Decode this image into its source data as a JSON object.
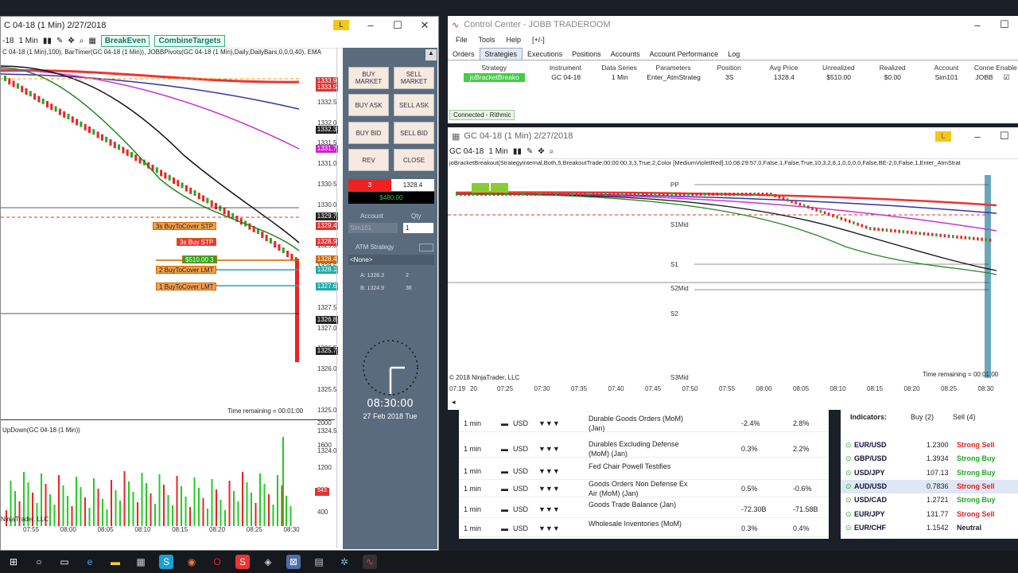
{
  "left_window": {
    "title": "C 04-18 (1 Min)  2/27/2018",
    "interval": "1 Min",
    "instrument": "-18",
    "breakeven_label": "BreakEven",
    "combine_label": "CombineTargets",
    "indicator_line": "C 04-18 (1 Min),100), BarTimer(GC 04-18 (1 Min)), JOBBPivots(GC 04-18 (1 Min),Daily,DailyBars,0,0,0,40), EMA",
    "price_ticks": [
      "1333.0",
      "1332.5",
      "1332.0",
      "1331.5",
      "1331.0",
      "1330.5",
      "1330.0",
      "1329.5",
      "1329.0",
      "1328.5",
      "1328.0",
      "1327.5",
      "1327.0",
      "1326.5",
      "1326.0",
      "1325.5",
      "1325.0",
      "1324.5",
      "1324.0"
    ],
    "price_labels": [
      {
        "text": "1333.9",
        "color": "#d33"
      },
      {
        "text": "1333.5",
        "color": "#d33"
      },
      {
        "text": "1332.3",
        "color": "#222"
      },
      {
        "text": "1331.7",
        "color": "#c2c"
      },
      {
        "text": "1329.7",
        "color": "#222"
      },
      {
        "text": "1329.4",
        "color": "#d33"
      },
      {
        "text": "1328.9",
        "color": "#d33"
      },
      {
        "text": "1328.4",
        "color": "#c60"
      },
      {
        "text": "1328.1",
        "color": "#2aa"
      },
      {
        "text": "1327.6",
        "color": "#2aa"
      },
      {
        "text": "1326.8",
        "color": "#222"
      },
      {
        "text": "1325.7",
        "color": "#222"
      }
    ],
    "orders": [
      {
        "text": "3s  BuyToCover STP",
        "bg": "#f6a04a"
      },
      {
        "text": "3s  Buy STP",
        "bg": "#e33"
      },
      {
        "text": "$510.00  3",
        "bg": "#2a2"
      },
      {
        "text": "2  BuyToCover LMT",
        "bg": "#f6a04a"
      },
      {
        "text": "1  BuyToCover LMT",
        "bg": "#f6a04a"
      }
    ],
    "time_remaining": "Time remaining = 00:01:00",
    "volume_title": "UpDown(GC 04-18 (1 Min))",
    "volume_ticks": [
      "2000",
      "1600",
      "1200",
      "800",
      "400"
    ],
    "volume_tag": "543",
    "copyright": "NinjaTrader, LLC",
    "time_ticks": [
      "07:55",
      "08:00",
      "08:05",
      "08:10",
      "08:15",
      "08:20",
      "08:25",
      "08:30"
    ]
  },
  "chart_trader": {
    "buy_market": "BUY MARKET",
    "sell_market": "SELL MARKET",
    "buy_ask": "BUY ASK",
    "sell_ask": "SELL ASK",
    "buy_bid": "BUY BID",
    "sell_bid": "SELL BID",
    "rev": "REV",
    "close": "CLOSE",
    "position_qty": "3",
    "position_price": "1328.4",
    "pnl": "$480.00",
    "account_label": "Account",
    "qty_label": "Qty",
    "account": "Sim101",
    "qty": "1",
    "atm_label": "ATM Strategy",
    "atm_value": "<None>",
    "ask": "A: 1328.3",
    "ask_size": "2",
    "bid": "B: 1324.9",
    "bid_size": "36",
    "clock_time": "08:30:00",
    "clock_date": "27 Feb 2018 Tue"
  },
  "control_center": {
    "title": "Control Center - JOBB TRADEROOM",
    "menu": [
      "File",
      "Tools",
      "Help",
      "[+/-]"
    ],
    "tabs": [
      "Orders",
      "Strategies",
      "Executions",
      "Positions",
      "Accounts",
      "Account Performance",
      "Log"
    ],
    "columns": [
      "Strategy",
      "Instrument",
      "Data Series",
      "Parameters",
      "Position",
      "Avg Price",
      "Unrealized",
      "Realized",
      "Account",
      "Conne",
      "Enable"
    ],
    "row": [
      "joBracketBreako",
      "GC 04-18",
      "1 Min",
      "Enter_AtmStrateg",
      "3S",
      "1328.4",
      "$510.00",
      "$0.00",
      "Sim101",
      "JOBB",
      ""
    ],
    "status": "Connected - Rithmic"
  },
  "right_chart": {
    "title": "GC 04-18 (1 Min)  2/27/2018",
    "instrument": "GC 04-18",
    "interval": "1 Min",
    "strategy_line": "joBracketBreakout(StrategyInternal,Both,5,BreakoutTrade,00:00:00,3,3,True,2,Color [MediumVioletRed],10,08:29:57,0,False,1,False,True,10,3,2,8,1,0,0,0,0,False,BE-2,0,False,1,Enter_AtmStrat",
    "pivots": [
      "PP",
      "S1Mid",
      "S1",
      "S2Mid",
      "S2",
      "S3Mid"
    ],
    "copyright": "© 2018 NinjaTrader, LLC",
    "time_remaining": "Time remaining = 00:01:00",
    "time_ticks": [
      "07:19",
      "20",
      "07:25",
      "07:30",
      "07:35",
      "07:40",
      "07:45",
      "07:50",
      "07:55",
      "08:00",
      "08:05",
      "08:10",
      "08:15",
      "08:20",
      "08:25",
      "08:30"
    ]
  },
  "calendar": [
    {
      "period": "1 min",
      "currency": "USD",
      "event": "Durable Goods Orders (MoM)",
      "event2": "(Jan)",
      "actual": "-2.4%",
      "forecast": "2.8%"
    },
    {
      "period": "1 min",
      "currency": "USD",
      "event": "Durables Excluding Defense",
      "event2": "(MoM) (Jan)",
      "actual": "0.3%",
      "forecast": "2.2%"
    },
    {
      "period": "1 min",
      "currency": "USD",
      "event": "Fed Chair Powell Testifies",
      "event2": "",
      "actual": "",
      "forecast": ""
    },
    {
      "period": "1 min",
      "currency": "USD",
      "event": "Goods Orders Non Defense Ex",
      "event2": "Air (MoM) (Jan)",
      "actual": "0.5%",
      "forecast": "-0.6%"
    },
    {
      "period": "1 min",
      "currency": "USD",
      "event": "Goods Trade Balance (Jan)",
      "event2": "",
      "actual": "-72.30B",
      "forecast": "-71.58B"
    },
    {
      "period": "1 min",
      "currency": "USD",
      "event": "Wholesale Inventories (MoM)",
      "event2": "",
      "actual": "0.3%",
      "forecast": "0.4%"
    }
  ],
  "indicators": {
    "title": "Indicators:",
    "buy": "Buy (2)",
    "sell": "Sell (4)",
    "rows": [
      {
        "pair": "EUR/USD",
        "value": "1.2300",
        "signal": "Strong Sell",
        "color": "#d22"
      },
      {
        "pair": "GBP/USD",
        "value": "1.3934",
        "signal": "Strong Buy",
        "color": "#2a2"
      },
      {
        "pair": "USD/JPY",
        "value": "107.13",
        "signal": "Strong Buy",
        "color": "#2a2"
      },
      {
        "pair": "AUD/USD",
        "value": "0.7836",
        "signal": "Strong Sell",
        "color": "#d22"
      },
      {
        "pair": "USD/CAD",
        "value": "1.2721",
        "signal": "Strong Buy",
        "color": "#2a2"
      },
      {
        "pair": "EUR/JPY",
        "value": "131.77",
        "signal": "Strong Sell",
        "color": "#d22"
      },
      {
        "pair": "EUR/CHF",
        "value": "1.1542",
        "signal": "Neutral",
        "color": "#222"
      }
    ]
  }
}
